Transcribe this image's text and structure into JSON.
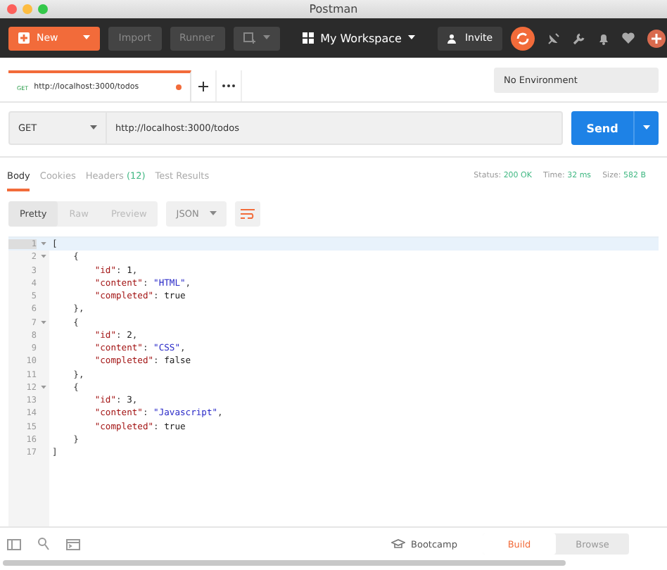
{
  "window": {
    "title": "Postman"
  },
  "toolbar": {
    "new": "New",
    "import": "Import",
    "runner": "Runner",
    "workspace": "My Workspace",
    "invite": "Invite"
  },
  "tabs": [
    {
      "method": "GET",
      "label": "http://localhost:3000/todos",
      "selected": true,
      "unsaved": true
    }
  ],
  "environment": "No Environment",
  "request": {
    "method": "GET",
    "url": "http://localhost:3000/todos",
    "send": "Send"
  },
  "response_tabs": [
    {
      "label": "Body",
      "selected": true
    },
    {
      "label": "Cookies",
      "selected": false
    },
    {
      "label": "Headers",
      "count": "(12)",
      "selected": false
    },
    {
      "label": "Test Results",
      "selected": false
    }
  ],
  "status": [
    {
      "label": "Status:",
      "value": "200 OK"
    },
    {
      "label": "Time:",
      "value": "32 ms"
    },
    {
      "label": "Size:",
      "value": "582 B"
    }
  ],
  "view_modes": [
    {
      "label": "Pretty",
      "selected": true
    },
    {
      "label": "Raw",
      "selected": false
    },
    {
      "label": "Preview",
      "selected": false
    }
  ],
  "format": "JSON",
  "code_lines": [
    {
      "number": "1",
      "foldable": true,
      "active": true,
      "tokens": [
        {
          "kind": "punct",
          "text": "["
        }
      ]
    },
    {
      "number": "2",
      "foldable": true,
      "active": false,
      "tokens": [
        {
          "kind": "punct",
          "text": "    {"
        }
      ]
    },
    {
      "number": "3",
      "foldable": false,
      "active": false,
      "tokens": [
        {
          "kind": "key",
          "text": "        \"id\""
        },
        {
          "kind": "punct",
          "text": ": "
        },
        {
          "kind": "literal",
          "text": "1"
        },
        {
          "kind": "punct",
          "text": ","
        }
      ]
    },
    {
      "number": "4",
      "foldable": false,
      "active": false,
      "tokens": [
        {
          "kind": "key",
          "text": "        \"content\""
        },
        {
          "kind": "punct",
          "text": ": "
        },
        {
          "kind": "string",
          "text": "\"HTML\""
        },
        {
          "kind": "punct",
          "text": ","
        }
      ]
    },
    {
      "number": "5",
      "foldable": false,
      "active": false,
      "tokens": [
        {
          "kind": "key",
          "text": "        \"completed\""
        },
        {
          "kind": "punct",
          "text": ": "
        },
        {
          "kind": "literal",
          "text": "true"
        }
      ]
    },
    {
      "number": "6",
      "foldable": false,
      "active": false,
      "tokens": [
        {
          "kind": "punct",
          "text": "    },"
        }
      ]
    },
    {
      "number": "7",
      "foldable": true,
      "active": false,
      "tokens": [
        {
          "kind": "punct",
          "text": "    {"
        }
      ]
    },
    {
      "number": "8",
      "foldable": false,
      "active": false,
      "tokens": [
        {
          "kind": "key",
          "text": "        \"id\""
        },
        {
          "kind": "punct",
          "text": ": "
        },
        {
          "kind": "literal",
          "text": "2"
        },
        {
          "kind": "punct",
          "text": ","
        }
      ]
    },
    {
      "number": "9",
      "foldable": false,
      "active": false,
      "tokens": [
        {
          "kind": "key",
          "text": "        \"content\""
        },
        {
          "kind": "punct",
          "text": ": "
        },
        {
          "kind": "string",
          "text": "\"CSS\""
        },
        {
          "kind": "punct",
          "text": ","
        }
      ]
    },
    {
      "number": "10",
      "foldable": false,
      "active": false,
      "tokens": [
        {
          "kind": "key",
          "text": "        \"completed\""
        },
        {
          "kind": "punct",
          "text": ": "
        },
        {
          "kind": "literal",
          "text": "false"
        }
      ]
    },
    {
      "number": "11",
      "foldable": false,
      "active": false,
      "tokens": [
        {
          "kind": "punct",
          "text": "    },"
        }
      ]
    },
    {
      "number": "12",
      "foldable": true,
      "active": false,
      "tokens": [
        {
          "kind": "punct",
          "text": "    {"
        }
      ]
    },
    {
      "number": "13",
      "foldable": false,
      "active": false,
      "tokens": [
        {
          "kind": "key",
          "text": "        \"id\""
        },
        {
          "kind": "punct",
          "text": ": "
        },
        {
          "kind": "literal",
          "text": "3"
        },
        {
          "kind": "punct",
          "text": ","
        }
      ]
    },
    {
      "number": "14",
      "foldable": false,
      "active": false,
      "tokens": [
        {
          "kind": "key",
          "text": "        \"content\""
        },
        {
          "kind": "punct",
          "text": ": "
        },
        {
          "kind": "string",
          "text": "\"Javascript\""
        },
        {
          "kind": "punct",
          "text": ","
        }
      ]
    },
    {
      "number": "15",
      "foldable": false,
      "active": false,
      "tokens": [
        {
          "kind": "key",
          "text": "        \"completed\""
        },
        {
          "kind": "punct",
          "text": ": "
        },
        {
          "kind": "literal",
          "text": "true"
        }
      ]
    },
    {
      "number": "16",
      "foldable": false,
      "active": false,
      "tokens": [
        {
          "kind": "punct",
          "text": "    }"
        }
      ]
    },
    {
      "number": "17",
      "foldable": false,
      "active": false,
      "tokens": [
        {
          "kind": "punct",
          "text": "]"
        }
      ]
    }
  ],
  "footer": {
    "bootcamp": "Bootcamp",
    "modes": [
      {
        "label": "Build",
        "selected": true
      },
      {
        "label": "Browse",
        "selected": false
      }
    ]
  }
}
